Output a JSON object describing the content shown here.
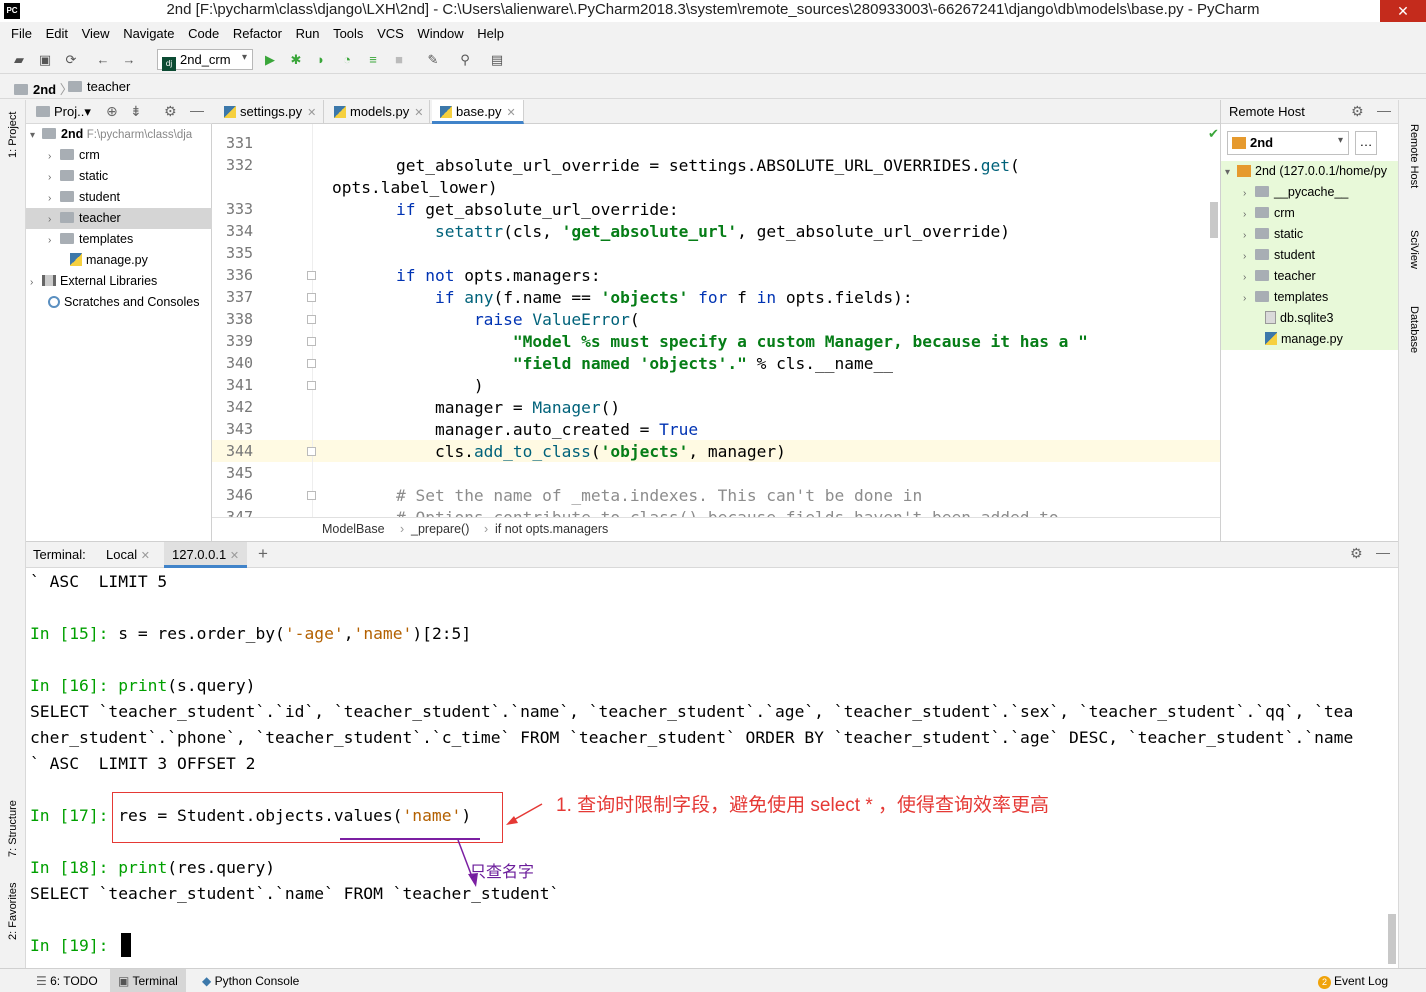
{
  "window": {
    "title": "2nd [F:\\pycharm\\class\\django\\LXH\\2nd] - C:\\Users\\alienware\\.PyCharm2018.3\\system\\remote_sources\\280933003\\-66267241\\django\\db\\models\\base.py - PyCharm",
    "app_icon": "PC"
  },
  "menu": [
    "File",
    "Edit",
    "View",
    "Navigate",
    "Code",
    "Refactor",
    "Run",
    "Tools",
    "VCS",
    "Window",
    "Help"
  ],
  "toolbar": {
    "run_config": "2nd_crm"
  },
  "nav": {
    "project": "2nd",
    "folder": "teacher"
  },
  "left_strip": {
    "project_tab": "1: Project",
    "structure_tab": "7: Structure",
    "favorites_tab": "2: Favorites"
  },
  "project_panel": {
    "header": "Proj..▾",
    "root": {
      "name": "2nd",
      "path": "F:\\pycharm\\class\\dja"
    },
    "items": [
      {
        "label": "crm",
        "type": "folder"
      },
      {
        "label": "static",
        "type": "folder"
      },
      {
        "label": "student",
        "type": "folder"
      },
      {
        "label": "teacher",
        "type": "folder",
        "selected": true
      },
      {
        "label": "templates",
        "type": "folder"
      },
      {
        "label": "manage.py",
        "type": "py"
      }
    ],
    "external": "External Libraries",
    "scratches": "Scratches and Consoles"
  },
  "editor": {
    "tabs": [
      {
        "label": "settings.py",
        "active": false
      },
      {
        "label": "models.py",
        "active": false
      },
      {
        "label": "base.py",
        "active": true
      }
    ],
    "lines": [
      {
        "num": "331",
        "text": ""
      },
      {
        "num": "332",
        "text": "        get_absolute_url_override = settings.ABSOLUTE_URL_OVERRIDES.get("
      },
      {
        "num": "",
        "text": "opts.label_lower)"
      },
      {
        "num": "333",
        "text": "        if get_absolute_url_override:"
      },
      {
        "num": "334",
        "text": "            setattr(cls, 'get_absolute_url', get_absolute_url_override)"
      },
      {
        "num": "335",
        "text": ""
      },
      {
        "num": "336",
        "text": "        if not opts.managers:"
      },
      {
        "num": "337",
        "text": "            if any(f.name == 'objects' for f in opts.fields):"
      },
      {
        "num": "338",
        "text": "                raise ValueError("
      },
      {
        "num": "339",
        "text": "                    \"Model %s must specify a custom Manager, because it has a \""
      },
      {
        "num": "340",
        "text": "                    \"field named 'objects'.\" % cls.__name__"
      },
      {
        "num": "341",
        "text": "                )"
      },
      {
        "num": "342",
        "text": "            manager = Manager()"
      },
      {
        "num": "343",
        "text": "            manager.auto_created = True"
      },
      {
        "num": "344",
        "text": "            cls.add_to_class('objects', manager)"
      },
      {
        "num": "345",
        "text": ""
      },
      {
        "num": "346",
        "text": "        # Set the name of _meta.indexes. This can't be done in"
      },
      {
        "num": "347",
        "text": "        # Options.contribute_to_class() because fields haven't been added to"
      }
    ],
    "breadcrumbs": [
      "ModelBase",
      "_prepare()",
      "if not opts.managers"
    ]
  },
  "remote_host": {
    "title": "Remote Host",
    "server": "2nd",
    "root": "2nd (127.0.0.1/home/py",
    "items": [
      {
        "label": "__pycache__",
        "type": "folder"
      },
      {
        "label": "crm",
        "type": "folder"
      },
      {
        "label": "static",
        "type": "folder"
      },
      {
        "label": "student",
        "type": "folder"
      },
      {
        "label": "teacher",
        "type": "folder"
      },
      {
        "label": "templates",
        "type": "folder"
      },
      {
        "label": "db.sqlite3",
        "type": "file"
      },
      {
        "label": "manage.py",
        "type": "py"
      }
    ]
  },
  "right_strip": {
    "remote_tab": "Remote Host",
    "sciview_tab": "SciView",
    "database_tab": "Database"
  },
  "terminal": {
    "label": "Terminal:",
    "tabs": [
      "Local",
      "127.0.0.1"
    ],
    "lines": [
      "` ASC  LIMIT 5",
      "",
      "In [15]: s = res.order_by('-age','name')[2:5]",
      "",
      "In [16]: print(s.query)",
      "SELECT `teacher_student`.`id`, `teacher_student`.`name`, `teacher_student`.`age`, `teacher_student`.`sex`, `teacher_student`.`qq`, `tea",
      "cher_student`.`phone`, `teacher_student`.`c_time` FROM `teacher_student` ORDER BY `teacher_student`.`age` DESC, `teacher_student`.`name",
      "` ASC  LIMIT 3 OFFSET 2",
      "",
      "In [17]: res = Student.objects.values('name')",
      "",
      "In [18]: print(res.query)",
      "SELECT `teacher_student`.`name` FROM `teacher_student`",
      "",
      "In [19]: "
    ]
  },
  "annotations": {
    "note1": "1. 查询时限制字段，避免使用 select * ，使得查询效率更高",
    "note2": "只查名字"
  },
  "statusbar": {
    "todo": "6: TODO",
    "terminal": "Terminal",
    "python_console": "Python Console",
    "event_count": "2",
    "event_log": "Event Log"
  },
  "colors": {
    "accent": "#4083c9",
    "annotation_red": "#e53935",
    "annotation_purple": "#7b1fa2",
    "remote_highlight": "#e8f9d9"
  }
}
